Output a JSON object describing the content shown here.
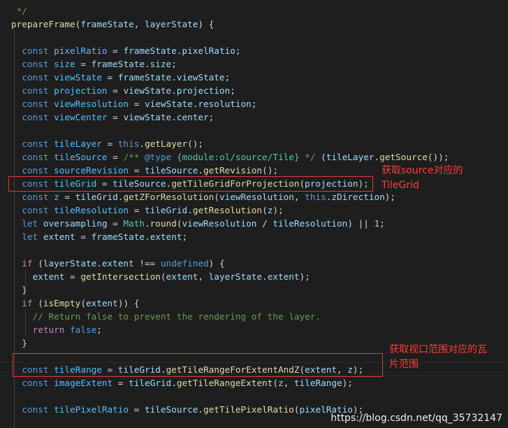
{
  "code_lines": [
    [
      {
        "t": " */",
        "c": "cmt"
      }
    ],
    [
      {
        "t": "prepareFrame",
        "c": "fn"
      },
      {
        "t": "(",
        "c": "plain"
      },
      {
        "t": "frameState",
        "c": "var"
      },
      {
        "t": ", ",
        "c": "plain"
      },
      {
        "t": "layerState",
        "c": "var"
      },
      {
        "t": ") {",
        "c": "plain"
      }
    ],
    [],
    [
      {
        "t": "  ",
        "c": "plain"
      },
      {
        "t": "const",
        "c": "kw"
      },
      {
        "t": " ",
        "c": "plain"
      },
      {
        "t": "pixelRatio",
        "c": "const"
      },
      {
        "t": " = ",
        "c": "plain"
      },
      {
        "t": "frameState",
        "c": "var"
      },
      {
        "t": ".",
        "c": "plain"
      },
      {
        "t": "pixelRatio",
        "c": "var"
      },
      {
        "t": ";",
        "c": "plain"
      }
    ],
    [
      {
        "t": "  ",
        "c": "plain"
      },
      {
        "t": "const",
        "c": "kw"
      },
      {
        "t": " ",
        "c": "plain"
      },
      {
        "t": "size",
        "c": "const"
      },
      {
        "t": " = ",
        "c": "plain"
      },
      {
        "t": "frameState",
        "c": "var"
      },
      {
        "t": ".",
        "c": "plain"
      },
      {
        "t": "size",
        "c": "var"
      },
      {
        "t": ";",
        "c": "plain"
      }
    ],
    [
      {
        "t": "  ",
        "c": "plain"
      },
      {
        "t": "const",
        "c": "kw"
      },
      {
        "t": " ",
        "c": "plain"
      },
      {
        "t": "viewState",
        "c": "const"
      },
      {
        "t": " = ",
        "c": "plain"
      },
      {
        "t": "frameState",
        "c": "var"
      },
      {
        "t": ".",
        "c": "plain"
      },
      {
        "t": "viewState",
        "c": "var"
      },
      {
        "t": ";",
        "c": "plain"
      }
    ],
    [
      {
        "t": "  ",
        "c": "plain"
      },
      {
        "t": "const",
        "c": "kw"
      },
      {
        "t": " ",
        "c": "plain"
      },
      {
        "t": "projection",
        "c": "const"
      },
      {
        "t": " = ",
        "c": "plain"
      },
      {
        "t": "viewState",
        "c": "var"
      },
      {
        "t": ".",
        "c": "plain"
      },
      {
        "t": "projection",
        "c": "var"
      },
      {
        "t": ";",
        "c": "plain"
      }
    ],
    [
      {
        "t": "  ",
        "c": "plain"
      },
      {
        "t": "const",
        "c": "kw"
      },
      {
        "t": " ",
        "c": "plain"
      },
      {
        "t": "viewResolution",
        "c": "const"
      },
      {
        "t": " = ",
        "c": "plain"
      },
      {
        "t": "viewState",
        "c": "var"
      },
      {
        "t": ".",
        "c": "plain"
      },
      {
        "t": "resolution",
        "c": "var"
      },
      {
        "t": ";",
        "c": "plain"
      }
    ],
    [
      {
        "t": "  ",
        "c": "plain"
      },
      {
        "t": "const",
        "c": "kw"
      },
      {
        "t": " ",
        "c": "plain"
      },
      {
        "t": "viewCenter",
        "c": "const"
      },
      {
        "t": " = ",
        "c": "plain"
      },
      {
        "t": "viewState",
        "c": "var"
      },
      {
        "t": ".",
        "c": "plain"
      },
      {
        "t": "center",
        "c": "var"
      },
      {
        "t": ";",
        "c": "plain"
      }
    ],
    [],
    [
      {
        "t": "  ",
        "c": "plain"
      },
      {
        "t": "const",
        "c": "kw"
      },
      {
        "t": " ",
        "c": "plain"
      },
      {
        "t": "tileLayer",
        "c": "const"
      },
      {
        "t": " = ",
        "c": "plain"
      },
      {
        "t": "this",
        "c": "kw"
      },
      {
        "t": ".",
        "c": "plain"
      },
      {
        "t": "getLayer",
        "c": "fn"
      },
      {
        "t": "();",
        "c": "plain"
      }
    ],
    [
      {
        "t": "  ",
        "c": "plain"
      },
      {
        "t": "const",
        "c": "kw"
      },
      {
        "t": " ",
        "c": "plain"
      },
      {
        "t": "tileSource",
        "c": "const"
      },
      {
        "t": " = ",
        "c": "plain"
      },
      {
        "t": "/** ",
        "c": "cmt"
      },
      {
        "t": "@type",
        "c": "kw"
      },
      {
        "t": " ",
        "c": "cmt"
      },
      {
        "t": "{module:ol/source/Tile}",
        "c": "type"
      },
      {
        "t": " */",
        "c": "cmt"
      },
      {
        "t": " (",
        "c": "plain"
      },
      {
        "t": "tileLayer",
        "c": "var"
      },
      {
        "t": ".",
        "c": "plain"
      },
      {
        "t": "getSource",
        "c": "fn"
      },
      {
        "t": "());",
        "c": "plain"
      }
    ],
    [
      {
        "t": "  ",
        "c": "plain"
      },
      {
        "t": "const",
        "c": "kw"
      },
      {
        "t": " ",
        "c": "plain"
      },
      {
        "t": "sourceRevision",
        "c": "const"
      },
      {
        "t": " = ",
        "c": "plain"
      },
      {
        "t": "tileSource",
        "c": "var"
      },
      {
        "t": ".",
        "c": "plain"
      },
      {
        "t": "getRevision",
        "c": "fn"
      },
      {
        "t": "();",
        "c": "plain"
      }
    ],
    [
      {
        "t": "  ",
        "c": "plain"
      },
      {
        "t": "const",
        "c": "kw"
      },
      {
        "t": " ",
        "c": "plain"
      },
      {
        "t": "tileGrid",
        "c": "const"
      },
      {
        "t": " = ",
        "c": "plain"
      },
      {
        "t": "tileSource",
        "c": "var"
      },
      {
        "t": ".",
        "c": "plain"
      },
      {
        "t": "getTileGridForProjection",
        "c": "fn"
      },
      {
        "t": "(",
        "c": "plain"
      },
      {
        "t": "projection",
        "c": "var"
      },
      {
        "t": ");",
        "c": "plain"
      }
    ],
    [
      {
        "t": "  ",
        "c": "plain"
      },
      {
        "t": "const",
        "c": "kw"
      },
      {
        "t": " ",
        "c": "plain"
      },
      {
        "t": "z",
        "c": "const"
      },
      {
        "t": " = ",
        "c": "plain"
      },
      {
        "t": "tileGrid",
        "c": "var"
      },
      {
        "t": ".",
        "c": "plain"
      },
      {
        "t": "getZForResolution",
        "c": "fn"
      },
      {
        "t": "(",
        "c": "plain"
      },
      {
        "t": "viewResolution",
        "c": "var"
      },
      {
        "t": ", ",
        "c": "plain"
      },
      {
        "t": "this",
        "c": "kw"
      },
      {
        "t": ".",
        "c": "plain"
      },
      {
        "t": "zDirection",
        "c": "var"
      },
      {
        "t": ");",
        "c": "plain"
      }
    ],
    [
      {
        "t": "  ",
        "c": "plain"
      },
      {
        "t": "const",
        "c": "kw"
      },
      {
        "t": " ",
        "c": "plain"
      },
      {
        "t": "tileResolution",
        "c": "const"
      },
      {
        "t": " = ",
        "c": "plain"
      },
      {
        "t": "tileGrid",
        "c": "var"
      },
      {
        "t": ".",
        "c": "plain"
      },
      {
        "t": "getResolution",
        "c": "fn"
      },
      {
        "t": "(",
        "c": "plain"
      },
      {
        "t": "z",
        "c": "var"
      },
      {
        "t": ");",
        "c": "plain"
      }
    ],
    [
      {
        "t": "  ",
        "c": "plain"
      },
      {
        "t": "let",
        "c": "kw"
      },
      {
        "t": " ",
        "c": "plain"
      },
      {
        "t": "oversampling",
        "c": "var"
      },
      {
        "t": " = ",
        "c": "plain"
      },
      {
        "t": "Math",
        "c": "type"
      },
      {
        "t": ".",
        "c": "plain"
      },
      {
        "t": "round",
        "c": "fn"
      },
      {
        "t": "(",
        "c": "plain"
      },
      {
        "t": "viewResolution",
        "c": "var"
      },
      {
        "t": " / ",
        "c": "plain"
      },
      {
        "t": "tileResolution",
        "c": "var"
      },
      {
        "t": ") || ",
        "c": "plain"
      },
      {
        "t": "1",
        "c": "num"
      },
      {
        "t": ";",
        "c": "plain"
      }
    ],
    [
      {
        "t": "  ",
        "c": "plain"
      },
      {
        "t": "let",
        "c": "kw"
      },
      {
        "t": " ",
        "c": "plain"
      },
      {
        "t": "extent",
        "c": "var"
      },
      {
        "t": " = ",
        "c": "plain"
      },
      {
        "t": "frameState",
        "c": "var"
      },
      {
        "t": ".",
        "c": "plain"
      },
      {
        "t": "extent",
        "c": "var"
      },
      {
        "t": ";",
        "c": "plain"
      }
    ],
    [],
    [
      {
        "t": "  ",
        "c": "plain"
      },
      {
        "t": "if",
        "c": "ctl"
      },
      {
        "t": " (",
        "c": "plain"
      },
      {
        "t": "layerState",
        "c": "var"
      },
      {
        "t": ".",
        "c": "plain"
      },
      {
        "t": "extent",
        "c": "var"
      },
      {
        "t": " !== ",
        "c": "plain"
      },
      {
        "t": "undefined",
        "c": "kw"
      },
      {
        "t": ") {",
        "c": "plain"
      }
    ],
    [
      {
        "t": "    ",
        "c": "plain"
      },
      {
        "t": "extent",
        "c": "var"
      },
      {
        "t": " = ",
        "c": "plain"
      },
      {
        "t": "getIntersection",
        "c": "fn"
      },
      {
        "t": "(",
        "c": "plain"
      },
      {
        "t": "extent",
        "c": "var"
      },
      {
        "t": ", ",
        "c": "plain"
      },
      {
        "t": "layerState",
        "c": "var"
      },
      {
        "t": ".",
        "c": "plain"
      },
      {
        "t": "extent",
        "c": "var"
      },
      {
        "t": ");",
        "c": "plain"
      }
    ],
    [
      {
        "t": "  }",
        "c": "plain"
      }
    ],
    [
      {
        "t": "  ",
        "c": "plain"
      },
      {
        "t": "if",
        "c": "ctl"
      },
      {
        "t": " (",
        "c": "plain"
      },
      {
        "t": "isEmpty",
        "c": "fn"
      },
      {
        "t": "(",
        "c": "plain"
      },
      {
        "t": "extent",
        "c": "var"
      },
      {
        "t": ")) {",
        "c": "plain"
      }
    ],
    [
      {
        "t": "    ",
        "c": "plain"
      },
      {
        "t": "// Return false to prevent the rendering of the layer.",
        "c": "cmt"
      }
    ],
    [
      {
        "t": "    ",
        "c": "plain"
      },
      {
        "t": "return",
        "c": "ctl"
      },
      {
        "t": " ",
        "c": "plain"
      },
      {
        "t": "false",
        "c": "kw"
      },
      {
        "t": ";",
        "c": "plain"
      }
    ],
    [
      {
        "t": "  }",
        "c": "plain"
      }
    ],
    [],
    [
      {
        "t": "  ",
        "c": "plain"
      },
      {
        "t": "const",
        "c": "kw"
      },
      {
        "t": " ",
        "c": "plain"
      },
      {
        "t": "tileRange",
        "c": "const"
      },
      {
        "t": " = ",
        "c": "plain"
      },
      {
        "t": "tileGrid",
        "c": "var"
      },
      {
        "t": ".",
        "c": "plain"
      },
      {
        "t": "getTileRangeForExtentAndZ",
        "c": "fn"
      },
      {
        "t": "(",
        "c": "plain"
      },
      {
        "t": "extent",
        "c": "var"
      },
      {
        "t": ", ",
        "c": "plain"
      },
      {
        "t": "z",
        "c": "var"
      },
      {
        "t": ");",
        "c": "plain"
      }
    ],
    [
      {
        "t": "  ",
        "c": "plain"
      },
      {
        "t": "const",
        "c": "kw"
      },
      {
        "t": " ",
        "c": "plain"
      },
      {
        "t": "imageExtent",
        "c": "const"
      },
      {
        "t": " = ",
        "c": "plain"
      },
      {
        "t": "tileGrid",
        "c": "var"
      },
      {
        "t": ".",
        "c": "plain"
      },
      {
        "t": "getTileRangeExtent",
        "c": "fn"
      },
      {
        "t": "(",
        "c": "plain"
      },
      {
        "t": "z",
        "c": "var"
      },
      {
        "t": ", ",
        "c": "plain"
      },
      {
        "t": "tileRange",
        "c": "var"
      },
      {
        "t": ");",
        "c": "plain"
      }
    ],
    [],
    [
      {
        "t": "  ",
        "c": "plain"
      },
      {
        "t": "const",
        "c": "kw"
      },
      {
        "t": " ",
        "c": "plain"
      },
      {
        "t": "tilePixelRatio",
        "c": "const"
      },
      {
        "t": " = ",
        "c": "plain"
      },
      {
        "t": "tileSource",
        "c": "var"
      },
      {
        "t": ".",
        "c": "plain"
      },
      {
        "t": "getTilePixelRatio",
        "c": "fn"
      },
      {
        "t": "(",
        "c": "plain"
      },
      {
        "t": "pixelRatio",
        "c": "var"
      },
      {
        "t": ");",
        "c": "plain"
      }
    ]
  ],
  "annotations": {
    "note1_line1": "获取source对应的",
    "note1_line2": "TileGrid",
    "note2_line1": "获取视口范围对应的瓦",
    "note2_line2": "片范围"
  },
  "watermark": "https://blog.csdn.net/qq_35732147",
  "colors": {
    "background": "#1e1e1e",
    "keyword": "#569cd6",
    "function": "#dcdcaa",
    "variable": "#9cdcfe",
    "constant": "#4fc1ff",
    "comment": "#6a9955",
    "annotation": "#e03c3c"
  }
}
